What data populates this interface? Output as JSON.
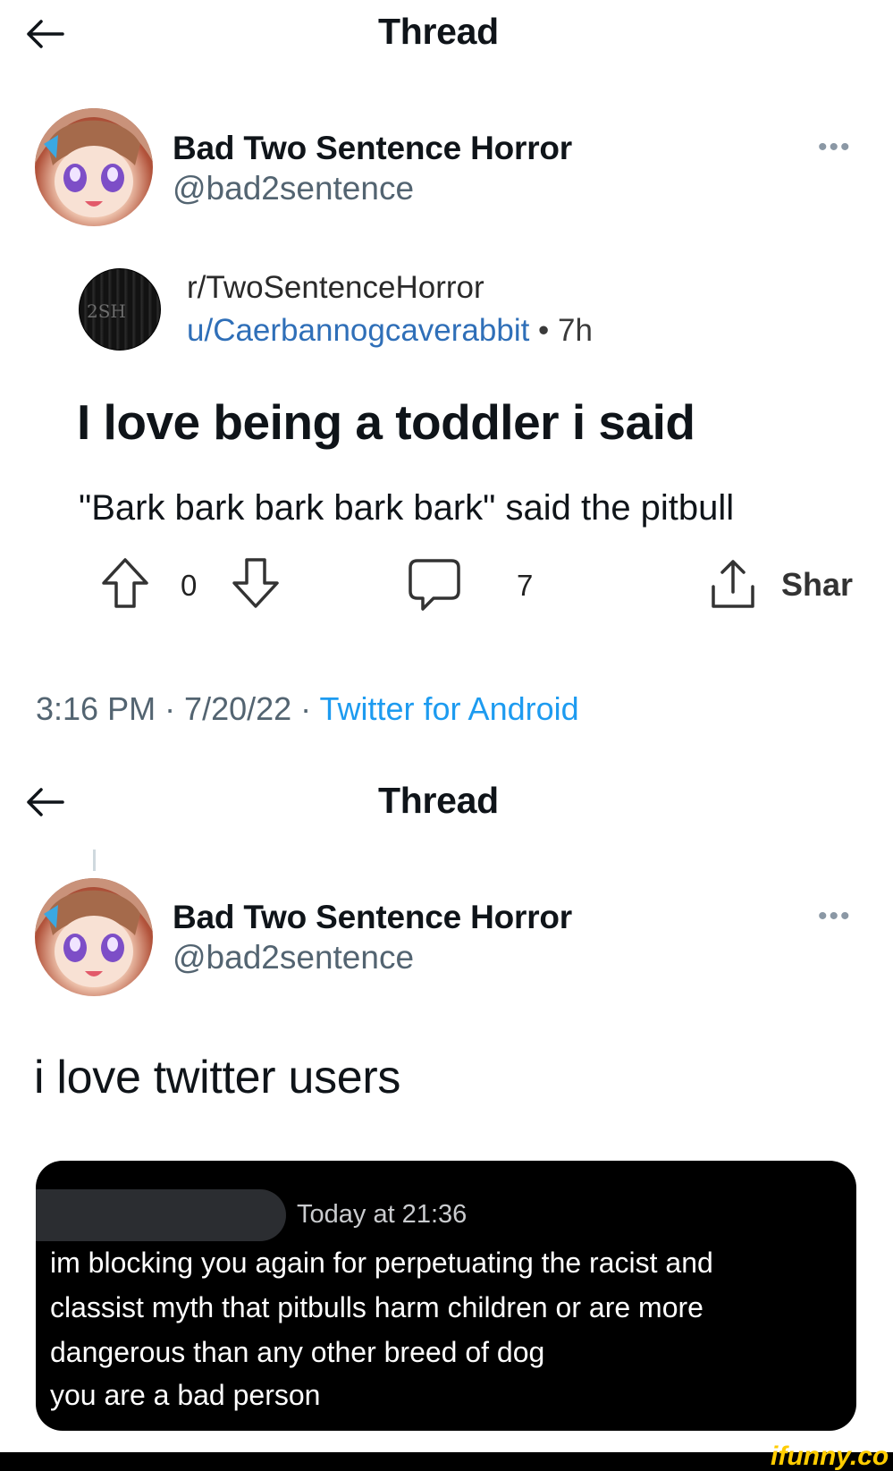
{
  "section1": {
    "header": {
      "title": "Thread"
    },
    "author": {
      "name": "Bad Two Sentence Horror",
      "handle": "@bad2sentence",
      "more": "•••"
    },
    "embed": {
      "avatar_text": "2SH",
      "subreddit": "r/TwoSentenceHorror",
      "user": "u/Caerbannogcaverabbit",
      "separator": " • ",
      "time": "7h",
      "title": "I love being a toddler i said",
      "body": "\"Bark bark bark bark bark\" said the pitbull",
      "actions": {
        "votes": "0",
        "comments": "7",
        "share": "Shar"
      }
    },
    "meta": {
      "time": "3:16 PM · 7/20/22 · ",
      "source": "Twitter for Android"
    }
  },
  "section2": {
    "header": {
      "title": "Thread"
    },
    "author": {
      "name": "Bad Two Sentence Horror",
      "handle": "@bad2sentence",
      "more": "•••"
    },
    "text": "i love twitter users",
    "screenshot_card": {
      "time": "Today at 21:36",
      "lines": [
        "im blocking you again for perpetuating the racist and",
        "classist myth that pitbulls harm children or are more",
        "dangerous than any other breed of dog",
        "you are a bad person"
      ]
    }
  },
  "watermark": "ifunny.co",
  "colors": {
    "link_blue": "#1d9bf0",
    "reddit_blue": "#2f6fb8",
    "grey": "#536471",
    "card_bg": "#000000"
  }
}
